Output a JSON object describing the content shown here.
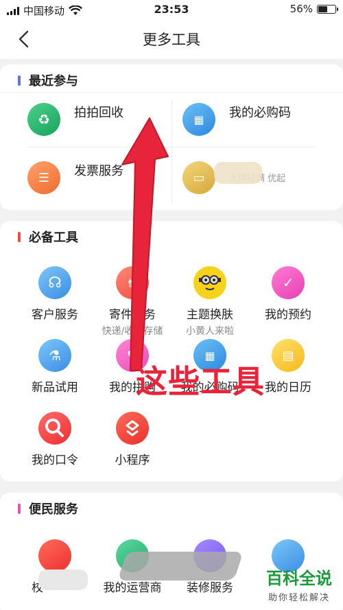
{
  "status_bar": {
    "carrier": "中国移动",
    "time": "23:53",
    "battery": "56%",
    "battery_level": 0.56
  },
  "nav": {
    "title": "更多工具"
  },
  "recent": {
    "title": "最近参与",
    "items": [
      {
        "label": "拍拍回收",
        "sub": ""
      },
      {
        "label": "我的必购码",
        "sub": ""
      },
      {
        "label": "发票服务",
        "sub": ""
      },
      {
        "label": "",
        "sub": "大牌拉满 优起"
      }
    ]
  },
  "essential": {
    "title": "必备工具",
    "items": [
      {
        "label": "客户服务",
        "sub": ""
      },
      {
        "label": "寄件服务",
        "sub": "快递/收纳存储"
      },
      {
        "label": "主题换肤",
        "sub": "小黄人来啦"
      },
      {
        "label": "我的预约",
        "sub": ""
      },
      {
        "label": "新品试用",
        "sub": ""
      },
      {
        "label": "我的拼购",
        "sub": ""
      },
      {
        "label": "我的必购码",
        "sub": ""
      },
      {
        "label": "我的日历",
        "sub": ""
      },
      {
        "label": "我的口令",
        "sub": ""
      },
      {
        "label": "小程序",
        "sub": ""
      }
    ]
  },
  "services": {
    "title": "便民服务",
    "items": [
      {
        "label": "校",
        "sub": ""
      },
      {
        "label": "我的运营商",
        "sub": ""
      },
      {
        "label": "装修服务",
        "sub": ""
      },
      {
        "label": "",
        "sub": ""
      }
    ]
  },
  "annotation": {
    "text": "这些工具"
  },
  "watermark": {
    "title": "百科全说",
    "subtitle": "助你轻松解决"
  },
  "colors": {
    "accent_red": "#e8243a",
    "brand_green": "#1a9a3a"
  }
}
